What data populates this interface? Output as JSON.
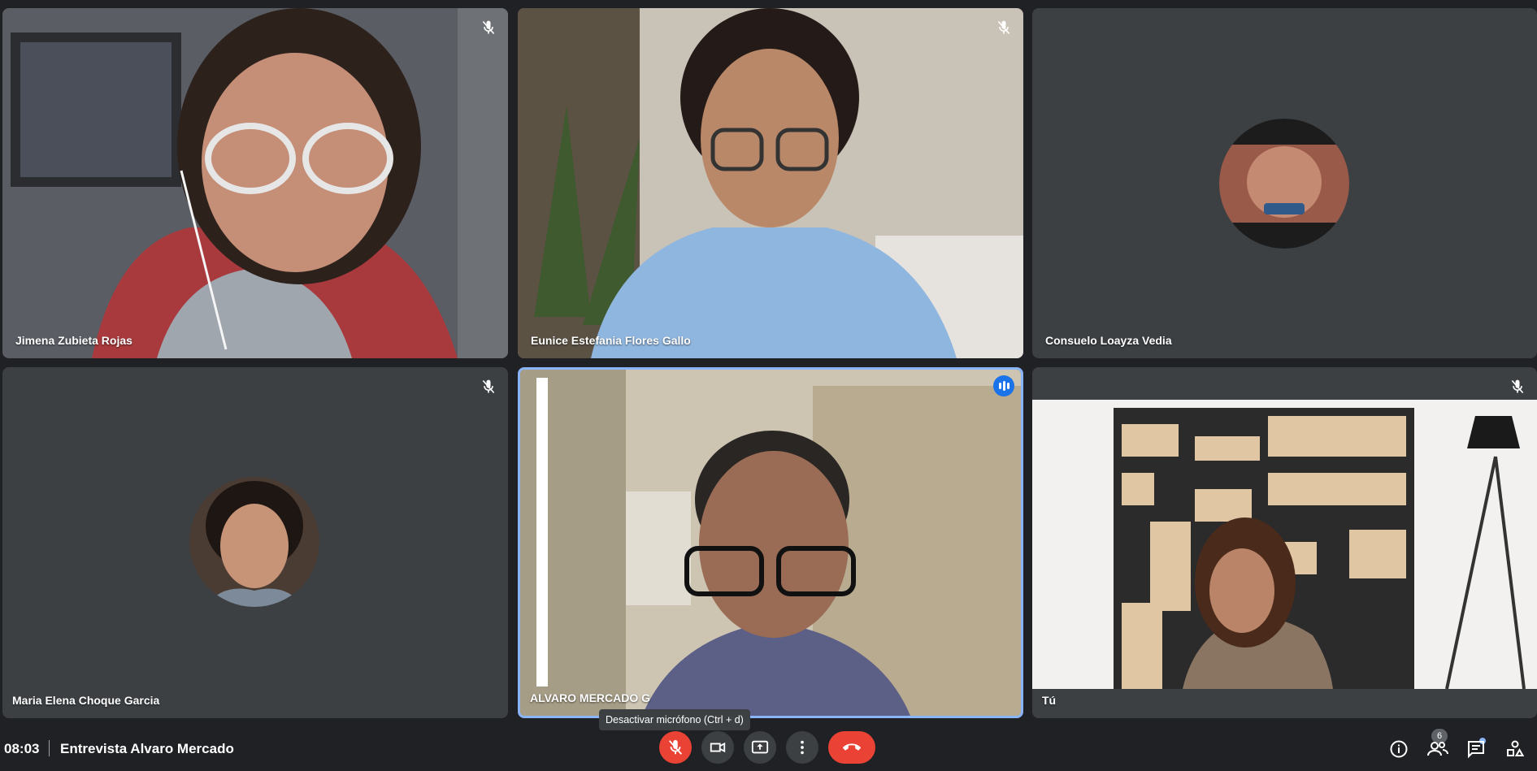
{
  "participants": [
    {
      "name": "Jimena Zubieta Rojas",
      "muted": true,
      "video": "camera"
    },
    {
      "name": "Eunice Estefania Flores Gallo",
      "muted": true,
      "video": "camera"
    },
    {
      "name": "Consuelo Loayza Vedia",
      "muted": false,
      "video": "avatar"
    },
    {
      "name": "Maria Elena Choque Garcia",
      "muted": true,
      "video": "avatar"
    },
    {
      "name": "ALVARO MERCADO G",
      "muted": false,
      "speaking": true,
      "video": "camera"
    },
    {
      "name": "Tú",
      "muted": true,
      "video": "camera"
    }
  ],
  "meeting": {
    "time": "08:03",
    "title": "Entrevista Alvaro Mercado"
  },
  "controls": {
    "mic_tooltip": "Desactivar micrófono (Ctrl + d)",
    "participants_count": "6"
  },
  "icons": [
    "mic-off-icon",
    "camera-icon",
    "present-screen-icon",
    "more-options-icon",
    "end-call-icon",
    "info-icon",
    "people-icon",
    "chat-icon",
    "activities-icon"
  ],
  "colors": {
    "background": "#202124",
    "tile": "#3c4043",
    "accent": "#8ab4f8",
    "end_call": "#ea4335",
    "speaking": "#1a73e8"
  }
}
